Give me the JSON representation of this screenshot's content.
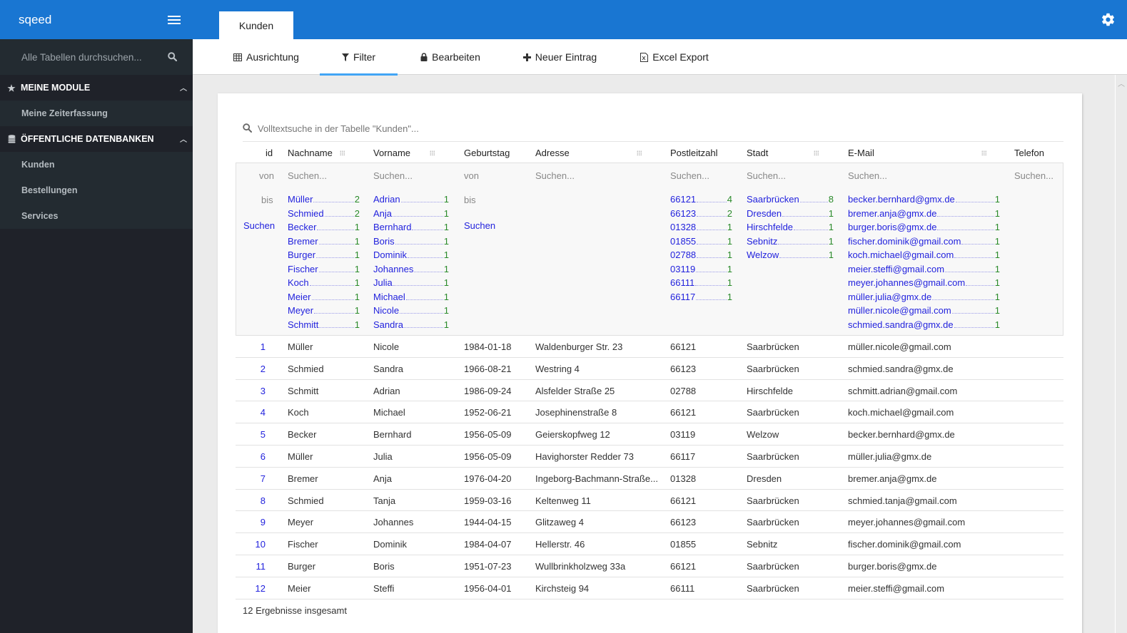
{
  "app": {
    "brand": "sqeed"
  },
  "sidebar": {
    "search_placeholder": "Alle Tabellen durchsuchen...",
    "sections": [
      {
        "title": "MEINE MODULE",
        "icon": "star-icon",
        "items": [
          {
            "label": "Meine Zeiterfassung"
          }
        ]
      },
      {
        "title": "ÖFFENTLICHE DATENBANKEN",
        "icon": "database-icon",
        "items": [
          {
            "label": "Kunden"
          },
          {
            "label": "Bestellungen"
          },
          {
            "label": "Services"
          }
        ]
      }
    ]
  },
  "topbar": {
    "active_tab": "Kunden"
  },
  "toolbar": {
    "items": [
      {
        "label": "Ausrichtung",
        "icon": "table-icon"
      },
      {
        "label": "Filter",
        "icon": "filter-icon",
        "active": true
      },
      {
        "label": "Bearbeiten",
        "icon": "lock-icon"
      },
      {
        "label": "Neuer Eintrag",
        "icon": "plus-icon"
      },
      {
        "label": "Excel Export",
        "icon": "excel-file-icon"
      }
    ]
  },
  "table": {
    "fulltext_placeholder": "Volltextsuche in der Tabelle \"Kunden\"...",
    "columns": [
      "id",
      "Nachname",
      "Vorname",
      "Geburtstag",
      "Adresse",
      "Postleitzahl",
      "Stadt",
      "E-Mail",
      "Telefon"
    ],
    "filter": {
      "von": "von",
      "bis": "bis",
      "search_link": "Suchen",
      "search_placeholder": "Suchen...",
      "facets": {
        "nachname": [
          [
            "Müller",
            "2"
          ],
          [
            "Schmied",
            "2"
          ],
          [
            "Becker",
            "1"
          ],
          [
            "Bremer",
            "1"
          ],
          [
            "Burger",
            "1"
          ],
          [
            "Fischer",
            "1"
          ],
          [
            "Koch",
            "1"
          ],
          [
            "Meier",
            "1"
          ],
          [
            "Meyer",
            "1"
          ],
          [
            "Schmitt",
            "1"
          ]
        ],
        "vorname": [
          [
            "Adrian",
            "1"
          ],
          [
            "Anja",
            "1"
          ],
          [
            "Bernhard",
            "1"
          ],
          [
            "Boris",
            "1"
          ],
          [
            "Dominik",
            "1"
          ],
          [
            "Johannes",
            "1"
          ],
          [
            "Julia",
            "1"
          ],
          [
            "Michael",
            "1"
          ],
          [
            "Nicole",
            "1"
          ],
          [
            "Sandra",
            "1"
          ]
        ],
        "plz": [
          [
            "66121",
            "4"
          ],
          [
            "66123",
            "2"
          ],
          [
            "01328",
            "1"
          ],
          [
            "01855",
            "1"
          ],
          [
            "02788",
            "1"
          ],
          [
            "03119",
            "1"
          ],
          [
            "66111",
            "1"
          ],
          [
            "66117",
            "1"
          ]
        ],
        "stadt": [
          [
            "Saarbrücken",
            "8"
          ],
          [
            "Dresden",
            "1"
          ],
          [
            "Hirschfelde",
            "1"
          ],
          [
            "Sebnitz",
            "1"
          ],
          [
            "Welzow",
            "1"
          ]
        ],
        "email": [
          [
            "becker.bernhard@gmx.de",
            "1"
          ],
          [
            "bremer.anja@gmx.de",
            "1"
          ],
          [
            "burger.boris@gmx.de",
            "1"
          ],
          [
            "fischer.dominik@gmail.com",
            "1"
          ],
          [
            "koch.michael@gmail.com",
            "1"
          ],
          [
            "meier.steffi@gmail.com",
            "1"
          ],
          [
            "meyer.johannes@gmail.com",
            "1"
          ],
          [
            "müller.julia@gmx.de",
            "1"
          ],
          [
            "müller.nicole@gmail.com",
            "1"
          ],
          [
            "schmied.sandra@gmx.de",
            "1"
          ]
        ]
      }
    },
    "rows": [
      [
        "1",
        "Müller",
        "Nicole",
        "1984-01-18",
        "Waldenburger Str. 23",
        "66121",
        "Saarbrücken",
        "müller.nicole@gmail.com",
        ""
      ],
      [
        "2",
        "Schmied",
        "Sandra",
        "1966-08-21",
        "Westring 4",
        "66123",
        "Saarbrücken",
        "schmied.sandra@gmx.de",
        ""
      ],
      [
        "3",
        "Schmitt",
        "Adrian",
        "1986-09-24",
        "Alsfelder Straße 25",
        "02788",
        "Hirschfelde",
        "schmitt.adrian@gmail.com",
        ""
      ],
      [
        "4",
        "Koch",
        "Michael",
        "1952-06-21",
        "Josephinenstraße 8",
        "66121",
        "Saarbrücken",
        "koch.michael@gmail.com",
        ""
      ],
      [
        "5",
        "Becker",
        "Bernhard",
        "1956-05-09",
        "Geierskopfweg 12",
        "03119",
        "Welzow",
        "becker.bernhard@gmx.de",
        ""
      ],
      [
        "6",
        "Müller",
        "Julia",
        "1956-05-09",
        "Havighorster Redder 73",
        "66117",
        "Saarbrücken",
        "müller.julia@gmx.de",
        ""
      ],
      [
        "7",
        "Bremer",
        "Anja",
        "1976-04-20",
        "Ingeborg-Bachmann-Straße...",
        "01328",
        "Dresden",
        "bremer.anja@gmx.de",
        ""
      ],
      [
        "8",
        "Schmied",
        "Tanja",
        "1959-03-16",
        "Keltenweg 11",
        "66121",
        "Saarbrücken",
        "schmied.tanja@gmail.com",
        ""
      ],
      [
        "9",
        "Meyer",
        "Johannes",
        "1944-04-15",
        "Glitzaweg 4",
        "66123",
        "Saarbrücken",
        "meyer.johannes@gmail.com",
        ""
      ],
      [
        "10",
        "Fischer",
        "Dominik",
        "1984-04-07",
        "Hellerstr. 46",
        "01855",
        "Sebnitz",
        "fischer.dominik@gmail.com",
        ""
      ],
      [
        "11",
        "Burger",
        "Boris",
        "1951-07-23",
        "Wullbrinkholzweg 33a",
        "66121",
        "Saarbrücken",
        "burger.boris@gmx.de",
        ""
      ],
      [
        "12",
        "Meier",
        "Steffi",
        "1956-04-01",
        "Kirchsteig 94",
        "66111",
        "Saarbrücken",
        "meier.steffi@gmail.com",
        ""
      ]
    ],
    "result_count": "12 Ergebnisse insgesamt"
  }
}
